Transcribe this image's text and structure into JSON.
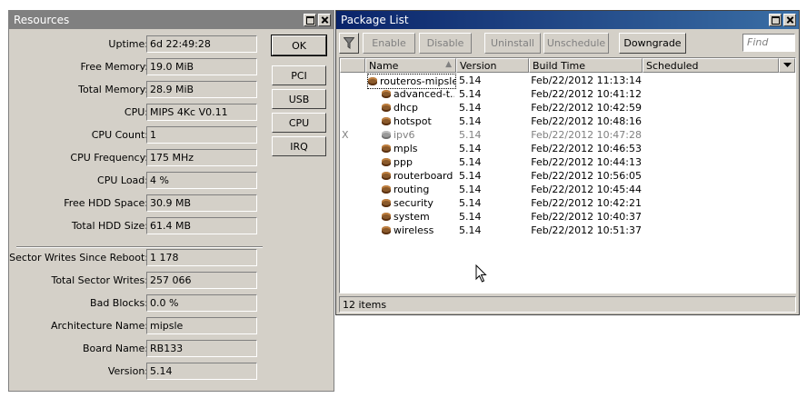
{
  "resources": {
    "title": "Resources",
    "rows": [
      {
        "label": "Uptime:",
        "value": "6d 22:49:28"
      },
      {
        "label": "Free Memory:",
        "value": "19.0 MiB"
      },
      {
        "label": "Total Memory:",
        "value": "28.9 MiB"
      },
      {
        "label": "CPU:",
        "value": "MIPS 4Kc V0.11"
      },
      {
        "label": "CPU Count:",
        "value": "1"
      },
      {
        "label": "CPU Frequency:",
        "value": "175 MHz"
      },
      {
        "label": "CPU Load:",
        "value": "4 %"
      },
      {
        "label": "Free HDD Space:",
        "value": "30.9 MB"
      },
      {
        "label": "Total HDD Size:",
        "value": "61.4 MB"
      },
      {
        "label": "Sector Writes Since Reboot:",
        "value": "1 178"
      },
      {
        "label": "Total Sector Writes:",
        "value": "257 066"
      },
      {
        "label": "Bad Blocks:",
        "value": "0.0 %"
      },
      {
        "label": "Architecture Name:",
        "value": "mipsle"
      },
      {
        "label": "Board Name:",
        "value": "RB133"
      },
      {
        "label": "Version:",
        "value": "5.14"
      }
    ],
    "buttons": {
      "ok": "OK",
      "pci": "PCI",
      "usb": "USB",
      "cpu": "CPU",
      "irq": "IRQ"
    }
  },
  "package_list": {
    "title": "Package List",
    "toolbar": {
      "filter_icon": "filter-icon",
      "enable": "Enable",
      "disable": "Disable",
      "uninstall": "Uninstall",
      "unschedule": "Unschedule",
      "downgrade": "Downgrade",
      "find_placeholder": "Find"
    },
    "columns": [
      "Name",
      "Version",
      "Build Time",
      "Scheduled"
    ],
    "rows": [
      {
        "flag": "",
        "name": "routeros-mipsle",
        "version": "5.14",
        "build": "Feb/22/2012 11:13:14",
        "scheduled": ""
      },
      {
        "flag": "",
        "name": "advanced-t...",
        "version": "5.14",
        "build": "Feb/22/2012 10:41:12",
        "scheduled": ""
      },
      {
        "flag": "",
        "name": "dhcp",
        "version": "5.14",
        "build": "Feb/22/2012 10:42:59",
        "scheduled": ""
      },
      {
        "flag": "",
        "name": "hotspot",
        "version": "5.14",
        "build": "Feb/22/2012 10:48:16",
        "scheduled": ""
      },
      {
        "flag": "X",
        "name": "ipv6",
        "version": "5.14",
        "build": "Feb/22/2012 10:47:28",
        "scheduled": ""
      },
      {
        "flag": "",
        "name": "mpls",
        "version": "5.14",
        "build": "Feb/22/2012 10:46:53",
        "scheduled": ""
      },
      {
        "flag": "",
        "name": "ppp",
        "version": "5.14",
        "build": "Feb/22/2012 10:44:13",
        "scheduled": ""
      },
      {
        "flag": "",
        "name": "routerboard",
        "version": "5.14",
        "build": "Feb/22/2012 10:56:05",
        "scheduled": ""
      },
      {
        "flag": "",
        "name": "routing",
        "version": "5.14",
        "build": "Feb/22/2012 10:45:44",
        "scheduled": ""
      },
      {
        "flag": "",
        "name": "security",
        "version": "5.14",
        "build": "Feb/22/2012 10:42:21",
        "scheduled": ""
      },
      {
        "flag": "",
        "name": "system",
        "version": "5.14",
        "build": "Feb/22/2012 10:40:37",
        "scheduled": ""
      },
      {
        "flag": "",
        "name": "wireless",
        "version": "5.14",
        "build": "Feb/22/2012 10:51:37",
        "scheduled": ""
      }
    ],
    "status": "12 items"
  }
}
